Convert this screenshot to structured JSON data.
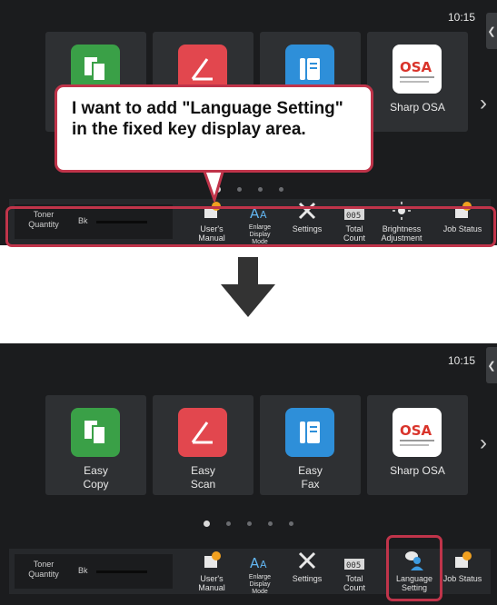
{
  "clock": "10:15",
  "edge_tab_icon": "chevron-left-icon",
  "callout_text": "I want to add \"Language Setting\" in the fixed key display area.",
  "toner": {
    "label": "Toner\nQuantity",
    "color": "Bk"
  },
  "tiles": [
    {
      "label": "Easy\nCopy",
      "icon": "copy-icon",
      "color": "#3aa047"
    },
    {
      "label": "Easy\nScan",
      "icon": "scan-icon",
      "color": "#e2474e"
    },
    {
      "label": "Easy\nFax",
      "icon": "fax-icon",
      "color": "#2e8fd9"
    },
    {
      "label": "Sharp OSA",
      "icon": "osa-icon",
      "color": "#ffffff"
    }
  ],
  "fixed_keys_before": [
    {
      "label": "User's\nManual",
      "icon": "manual-icon"
    },
    {
      "label": "Enlarge\nDisplay\nMode",
      "icon": "enlarge-display-icon"
    },
    {
      "label": "Settings",
      "icon": "settings-icon"
    },
    {
      "label": "Total\nCount",
      "icon": "counter-icon"
    },
    {
      "label": "Brightness\nAdjustment",
      "icon": "brightness-icon"
    },
    {
      "label": "Job Status",
      "icon": "job-status-icon"
    }
  ],
  "fixed_keys_after": [
    {
      "label": "User's\nManual",
      "icon": "manual-icon"
    },
    {
      "label": "Enlarge\nDisplay\nMode",
      "icon": "enlarge-display-icon"
    },
    {
      "label": "Settings",
      "icon": "settings-icon"
    },
    {
      "label": "Total\nCount",
      "icon": "counter-icon"
    },
    {
      "label": "Language\nSetting",
      "icon": "language-setting-icon"
    },
    {
      "label": "Job Status",
      "icon": "job-status-icon"
    }
  ],
  "page_dots_count": 5,
  "accent_color": "#c0344a"
}
